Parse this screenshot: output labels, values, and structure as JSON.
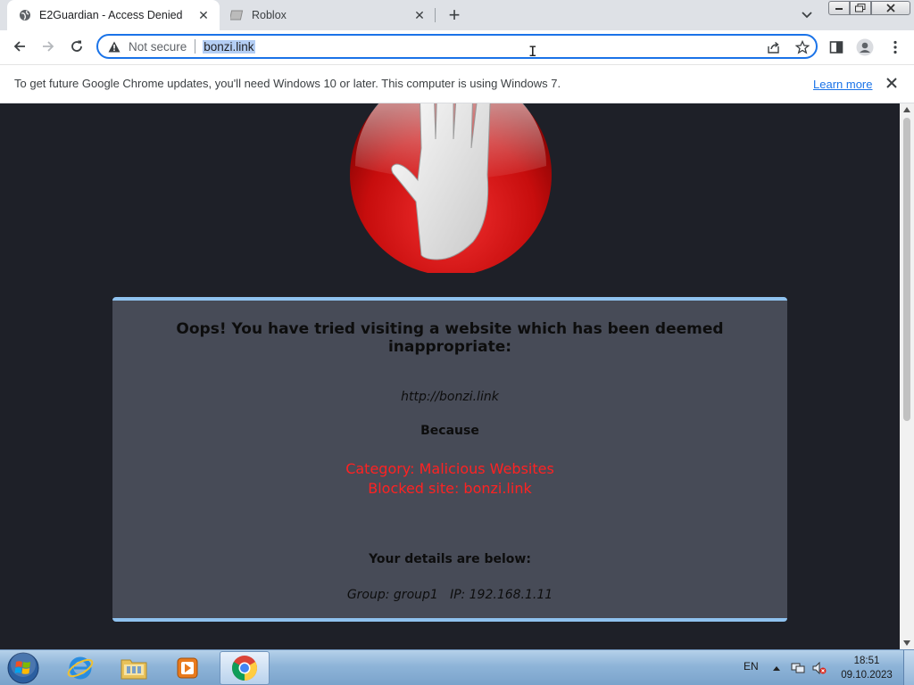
{
  "browser": {
    "tabs": [
      {
        "title": "E2Guardian - Access Denied",
        "active": true
      },
      {
        "title": "Roblox",
        "active": false
      }
    ],
    "address_bar": {
      "security_label": "Not secure",
      "url": "bonzi.link"
    },
    "infobar": {
      "message": "To get future Google Chrome updates, you'll need Windows 10 or later. This computer is using Windows 7.",
      "link_label": "Learn more"
    }
  },
  "page": {
    "heading": "Oops! You have tried visiting a website which has been deemed inappropriate:",
    "blocked_url": "http://bonzi.link",
    "because_label": "Because",
    "category_line": "Category: Malicious Websites",
    "blocked_site_line": "Blocked site: bonzi.link",
    "details_label": "Your details are below:",
    "group_info": "Group: group1   IP: 192.168.1.11"
  },
  "taskbar": {
    "language": "EN",
    "time": "18:51",
    "date": "09.10.2023"
  },
  "colors": {
    "accent": "#1a73e8",
    "page_bg": "#1e2028",
    "panel_bg": "#474b57",
    "panel_border": "#8fc2ef",
    "alert_text": "#ff2222"
  }
}
